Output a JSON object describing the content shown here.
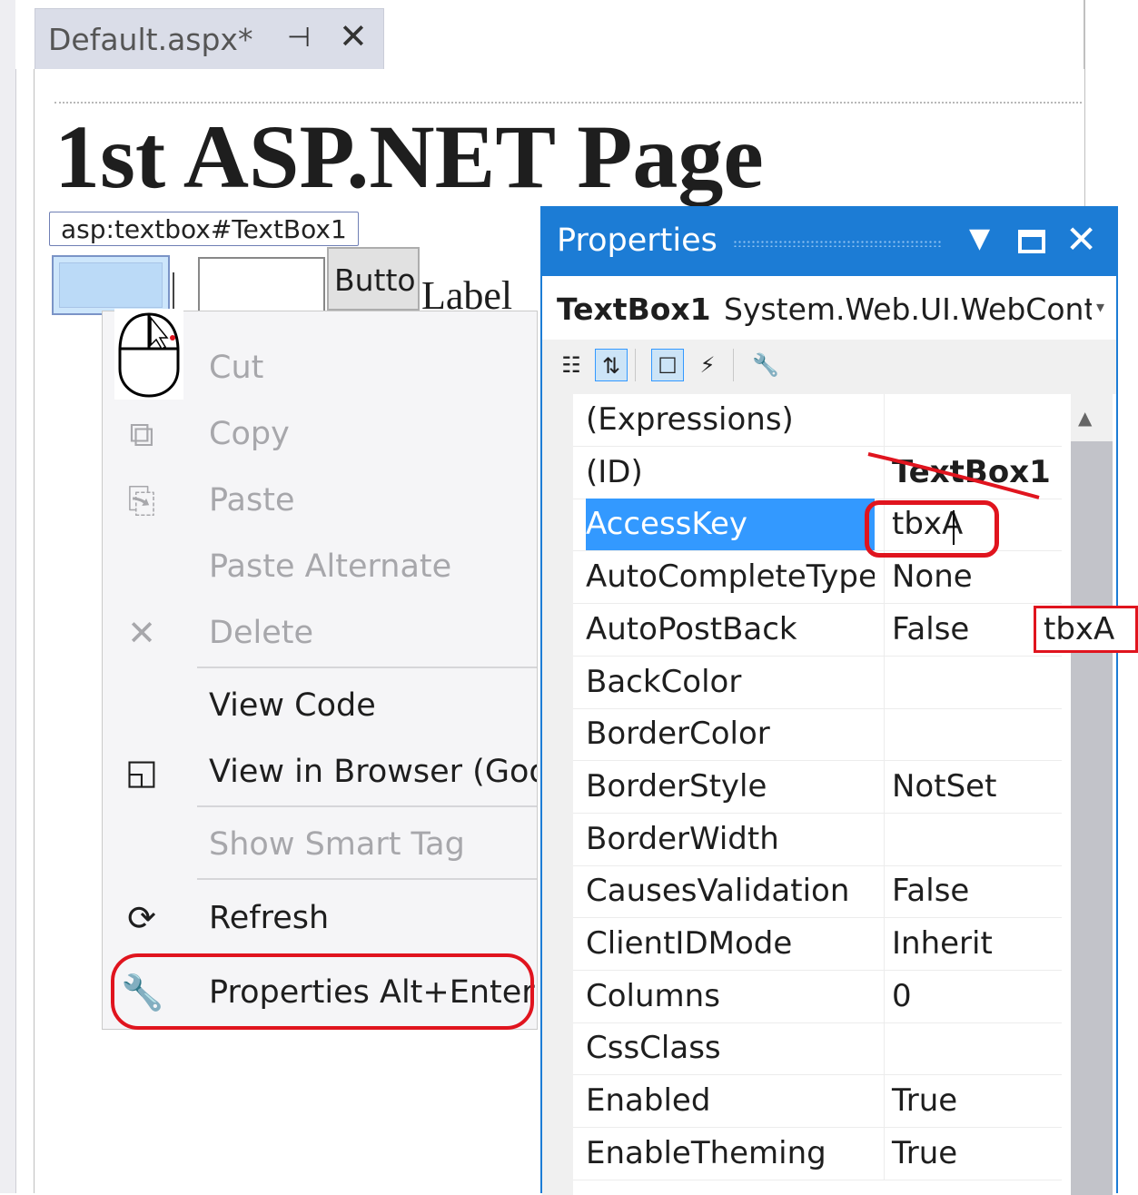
{
  "tab": {
    "title": "Default.aspx*",
    "pin_icon": "pin-icon",
    "close_icon": "close-icon"
  },
  "designer": {
    "heading": "1st ASP.NET Page",
    "tag_label": "asp:textbox#TextBox1",
    "button_text": "Button",
    "label_text": "Label"
  },
  "context_menu": {
    "items": [
      {
        "label": "Cut",
        "icon": "cut-icon",
        "enabled": false
      },
      {
        "label": "Copy",
        "icon": "copy-icon",
        "enabled": false
      },
      {
        "label": "Paste",
        "icon": "paste-icon",
        "enabled": false
      },
      {
        "label": "Paste Alternate",
        "icon": "",
        "enabled": false
      },
      {
        "label": "Delete",
        "icon": "delete-icon",
        "enabled": false
      },
      {
        "label": "View Code",
        "icon": "",
        "enabled": true
      },
      {
        "label": "View in Browser (Goo",
        "icon": "browser-icon",
        "enabled": true
      },
      {
        "label": "Show Smart Tag",
        "icon": "",
        "enabled": false
      },
      {
        "label": "Refresh",
        "icon": "refresh-icon",
        "enabled": true
      },
      {
        "label": "Properties  Alt+Enter",
        "icon": "wrench-icon",
        "enabled": true
      }
    ]
  },
  "properties": {
    "title": "Properties",
    "object_name": "TextBox1",
    "object_type": "System.Web.UI.WebControls.TextBox",
    "rows": [
      {
        "name": "(Expressions)",
        "value": ""
      },
      {
        "name": "(ID)",
        "value": "TextBox1"
      },
      {
        "name": "AccessKey",
        "value": "tbxA"
      },
      {
        "name": "AutoCompleteType",
        "value": "None"
      },
      {
        "name": "AutoPostBack",
        "value": "False"
      },
      {
        "name": "BackColor",
        "value": ""
      },
      {
        "name": "BorderColor",
        "value": ""
      },
      {
        "name": "BorderStyle",
        "value": "NotSet"
      },
      {
        "name": "BorderWidth",
        "value": ""
      },
      {
        "name": "CausesValidation",
        "value": "False"
      },
      {
        "name": "ClientIDMode",
        "value": "Inherit"
      },
      {
        "name": "Columns",
        "value": "0"
      },
      {
        "name": "CssClass",
        "value": ""
      },
      {
        "name": "Enabled",
        "value": "True"
      },
      {
        "name": "EnableTheming",
        "value": "True"
      }
    ],
    "selected_property": "AccessKey",
    "preview_value": "tbxA"
  },
  "colors": {
    "accent": "#1c7cd5",
    "annotation": "#e0141e",
    "selection": "#3399ff"
  }
}
